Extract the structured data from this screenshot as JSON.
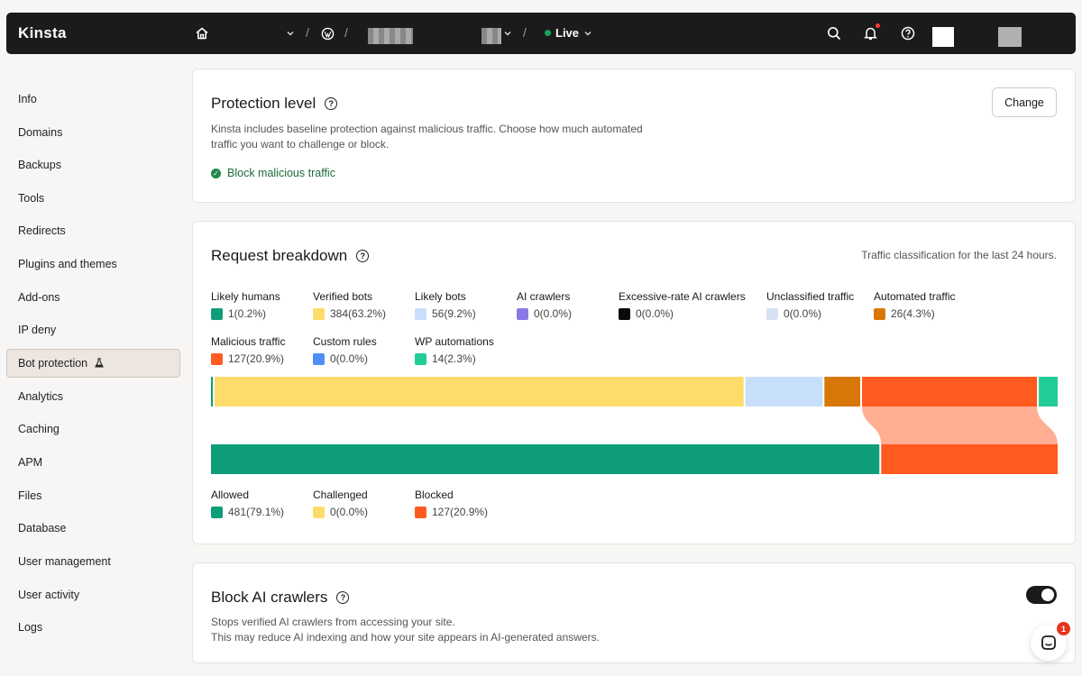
{
  "app": {
    "logo": "Kinsta"
  },
  "topbar": {
    "environment": "Live"
  },
  "sidebar": {
    "items": [
      {
        "label": "Info",
        "active": false
      },
      {
        "label": "Domains",
        "active": false
      },
      {
        "label": "Backups",
        "active": false
      },
      {
        "label": "Tools",
        "active": false
      },
      {
        "label": "Redirects",
        "active": false
      },
      {
        "label": "Plugins and themes",
        "active": false
      },
      {
        "label": "Add-ons",
        "active": false
      },
      {
        "label": "IP deny",
        "active": false
      },
      {
        "label": "Bot protection",
        "active": true,
        "icon": "flask-icon"
      },
      {
        "label": "Analytics",
        "active": false
      },
      {
        "label": "Caching",
        "active": false
      },
      {
        "label": "APM",
        "active": false
      },
      {
        "label": "Files",
        "active": false
      },
      {
        "label": "Database",
        "active": false
      },
      {
        "label": "User management",
        "active": false
      },
      {
        "label": "User activity",
        "active": false
      },
      {
        "label": "Logs",
        "active": false
      }
    ]
  },
  "protection": {
    "title": "Protection level",
    "description_line1": "Kinsta includes baseline protection against malicious traffic. Choose how much automated",
    "description_line2": "traffic you want to challenge or block.",
    "status": "Block malicious traffic",
    "change_label": "Change"
  },
  "breakdown": {
    "title": "Request breakdown",
    "subtitle": "Traffic classification for the last 24 hours.",
    "categories": [
      {
        "label": "Likely humans",
        "value": "1(0.2%)",
        "count": 1,
        "color": "#0f9e7a"
      },
      {
        "label": "Verified bots",
        "value": "384(63.2%)",
        "count": 384,
        "color": "#fddc6b"
      },
      {
        "label": "Likely bots",
        "value": "56(9.2%)",
        "count": 56,
        "color": "#c7dffa"
      },
      {
        "label": "AI crawlers",
        "value": "0(0.0%)",
        "count": 0,
        "color": "#8b78e6"
      },
      {
        "label": "Excessive-rate AI crawlers",
        "value": "0(0.0%)",
        "count": 0,
        "color": "#0a0a0a"
      },
      {
        "label": "Unclassified traffic",
        "value": "0(0.0%)",
        "count": 0,
        "color": "#d6e2f3"
      },
      {
        "label": "Automated traffic",
        "value": "26(4.3%)",
        "count": 26,
        "color": "#d97706"
      },
      {
        "label": "Malicious traffic",
        "value": "127(20.9%)",
        "count": 127,
        "color": "#ff5a1f"
      },
      {
        "label": "Custom rules",
        "value": "0(0.0%)",
        "count": 0,
        "color": "#4f8ff7"
      },
      {
        "label": "WP automations",
        "value": "14(2.3%)",
        "count": 14,
        "color": "#22cc97"
      }
    ],
    "outcomes": [
      {
        "label": "Allowed",
        "value": "481(79.1%)",
        "count": 481,
        "color": "#0f9e7a"
      },
      {
        "label": "Challenged",
        "value": "0(0.0%)",
        "count": 0,
        "color": "#fddc6b"
      },
      {
        "label": "Blocked",
        "value": "127(20.9%)",
        "count": 127,
        "color": "#ff5a1f"
      }
    ]
  },
  "ai_crawlers": {
    "title": "Block AI crawlers",
    "description_line1": "Stops verified AI crawlers from accessing your site.",
    "description_line2": "This may reduce AI indexing and how your site appears in AI-generated answers.",
    "enabled": true
  },
  "chat": {
    "badge": "1"
  }
}
